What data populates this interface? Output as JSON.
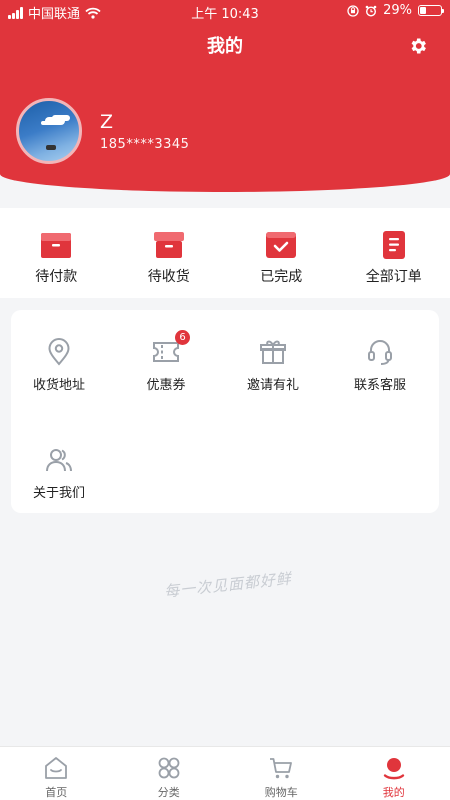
{
  "status_bar": {
    "carrier": "中国联通",
    "time": "上午 10:43",
    "battery": "29%"
  },
  "header": {
    "title": "我的"
  },
  "user": {
    "name": "Z",
    "phone": "185****3345"
  },
  "orders": [
    {
      "label": "待付款",
      "icon": "wallet-icon"
    },
    {
      "label": "待收货",
      "icon": "box-icon"
    },
    {
      "label": "已完成",
      "icon": "completed-box-icon"
    },
    {
      "label": "全部订单",
      "icon": "order-list-icon"
    }
  ],
  "services": [
    {
      "label": "收货地址",
      "icon": "location-pin-icon"
    },
    {
      "label": "优惠券",
      "icon": "coupon-icon",
      "badge": "6"
    },
    {
      "label": "邀请有礼",
      "icon": "gift-icon"
    },
    {
      "label": "联系客服",
      "icon": "headset-icon"
    },
    {
      "label": "关于我们",
      "icon": "users-icon"
    }
  ],
  "slogan": "每一次见面都好鲜",
  "tabs": [
    {
      "label": "首页",
      "icon": "home-icon"
    },
    {
      "label": "分类",
      "icon": "category-icon"
    },
    {
      "label": "购物车",
      "icon": "cart-icon"
    },
    {
      "label": "我的",
      "icon": "profile-icon",
      "active": true
    }
  ],
  "colors": {
    "brand_red": "#e0353c",
    "icon_gray": "#9aa0a8"
  }
}
